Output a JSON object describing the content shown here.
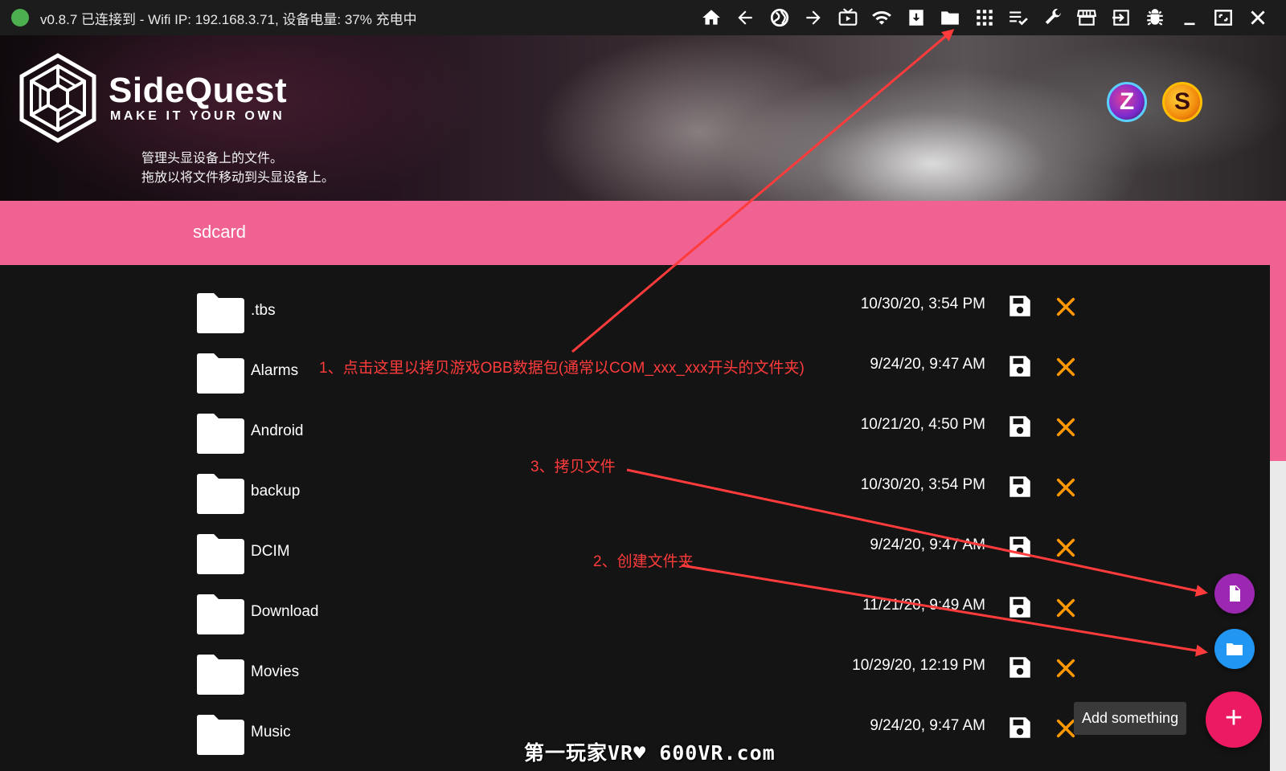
{
  "status": {
    "text": "v0.8.7  已连接到 - Wifi IP: 192.168.3.71, 设备电量: 37% 充电中",
    "dot_color": "#4caf50"
  },
  "toolbar": {
    "icons": [
      "home-icon",
      "back-arrow-icon",
      "globe-icon",
      "forward-arrow-icon",
      "tv-play-icon",
      "wifi-icon",
      "download-box-icon",
      "folder-icon",
      "apps-grid-icon",
      "playlist-check-icon",
      "wrench-icon",
      "store-icon",
      "sign-in-icon",
      "bug-icon",
      "minimize-icon",
      "maximize-icon",
      "close-icon"
    ]
  },
  "header": {
    "app_name": "SideQuest",
    "tagline": "MAKE IT YOUR OWN",
    "desc_line1": "管理头显设备上的文件。",
    "desc_line2": "拖放以将文件移动到头显设备上。",
    "badge_z": "Z",
    "badge_s": "S"
  },
  "path": {
    "label": "sdcard",
    "color": "#f06292"
  },
  "files": [
    {
      "name": ".tbs",
      "date": "10/30/20, 3:54 PM"
    },
    {
      "name": "Alarms",
      "date": "9/24/20, 9:47 AM"
    },
    {
      "name": "Android",
      "date": "10/21/20, 4:50 PM"
    },
    {
      "name": "backup",
      "date": "10/30/20, 3:54 PM"
    },
    {
      "name": "DCIM",
      "date": "9/24/20, 9:47 AM"
    },
    {
      "name": "Download",
      "date": "11/21/20, 9:49 AM"
    },
    {
      "name": "Movies",
      "date": "10/29/20, 12:19 PM"
    },
    {
      "name": "Music",
      "date": "9/24/20, 9:47 AM"
    }
  ],
  "fabs": {
    "tooltip": "Add something",
    "add_symbol": "+"
  },
  "annotations": {
    "a1": "1、点击这里以拷贝游戏OBB数据包(通常以COM_xxx_xxx开头的文件夹)",
    "a2": "2、创建文件夹",
    "a3": "3、拷贝文件"
  },
  "watermark": "第一玩家VR♥ 600VR.com",
  "colors": {
    "accent_pink": "#f06292",
    "delete_orange": "#ff9800",
    "annotation_red": "#ff3b3b",
    "fab_purple": "#9c27b0",
    "fab_blue": "#2196f3",
    "fab_red": "#ec1a63"
  }
}
